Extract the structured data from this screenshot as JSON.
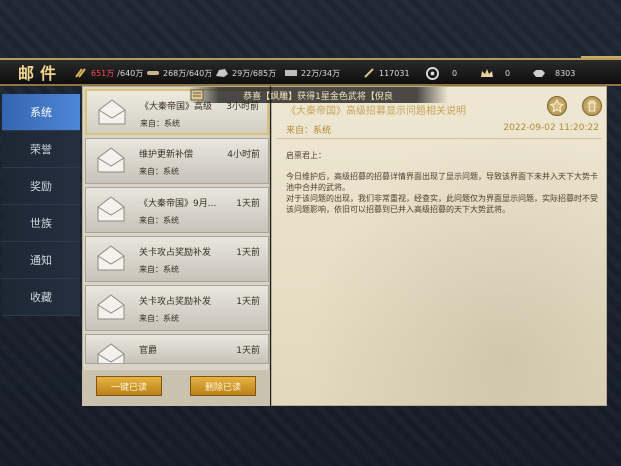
{
  "header": {
    "title": "邮件",
    "resources": [
      {
        "icon": "grain-icon",
        "value_warn": "651万",
        "value": "/640万"
      },
      {
        "icon": "wood-icon",
        "value": "268万/640万"
      },
      {
        "icon": "stone-icon",
        "value": "29万/685万"
      },
      {
        "icon": "iron-icon",
        "value": "22万/34万"
      },
      {
        "icon": "token-icon",
        "value": "117031"
      },
      {
        "icon": "coin-icon",
        "value": "0"
      },
      {
        "icon": "crown-icon",
        "value": "0"
      },
      {
        "icon": "ingot-icon",
        "value": "8303"
      }
    ]
  },
  "banner": {
    "text": "恭喜【飒雕】获得1星金色武将【倪良"
  },
  "sidebar": {
    "items": [
      {
        "label": "系统",
        "active": true
      },
      {
        "label": "荣誉"
      },
      {
        "label": "奖励"
      },
      {
        "label": "世族"
      },
      {
        "label": "通知"
      },
      {
        "label": "收藏"
      }
    ]
  },
  "mail_list": {
    "items": [
      {
        "title": "《大秦帝国》高级",
        "time": "3小时前",
        "from": "来自：系统",
        "selected": true
      },
      {
        "title": "维护更新补偿",
        "time": "4小时前",
        "from": "来自：系统"
      },
      {
        "title": "《大秦帝国》9月...",
        "time": "1天前",
        "from": "来自：系统"
      },
      {
        "title": "关卡攻占奖励补发",
        "time": "1天前",
        "from": "来自：系统"
      },
      {
        "title": "关卡攻占奖励补发",
        "time": "1天前",
        "from": "来自：系统"
      },
      {
        "title": "官爵",
        "time": "1天前",
        "from": ""
      }
    ],
    "read_all_label": "一键已读",
    "delete_read_label": "删除已读"
  },
  "detail": {
    "title": "《大秦帝国》高级招募显示问题相关说明",
    "from": "来自：系统",
    "date": "2022-09-02 11:20:22",
    "greeting": "启禀君上：",
    "paragraph1": "今日维护后，高级招募的招募详情界面出现了显示问题，导致该界面下未并入天下大势卡池中合并的武将。",
    "paragraph2": "对于该问题的出现，我们非常重视，经查实，此问题仅为界面显示问题，实际招募时不受该问题影响，依旧可以招募到已并入高级招募的天下大势武将。"
  },
  "colors": {
    "accent": "#4d87d6",
    "gold": "#c5a45a",
    "warn": "#ff4b4b"
  }
}
